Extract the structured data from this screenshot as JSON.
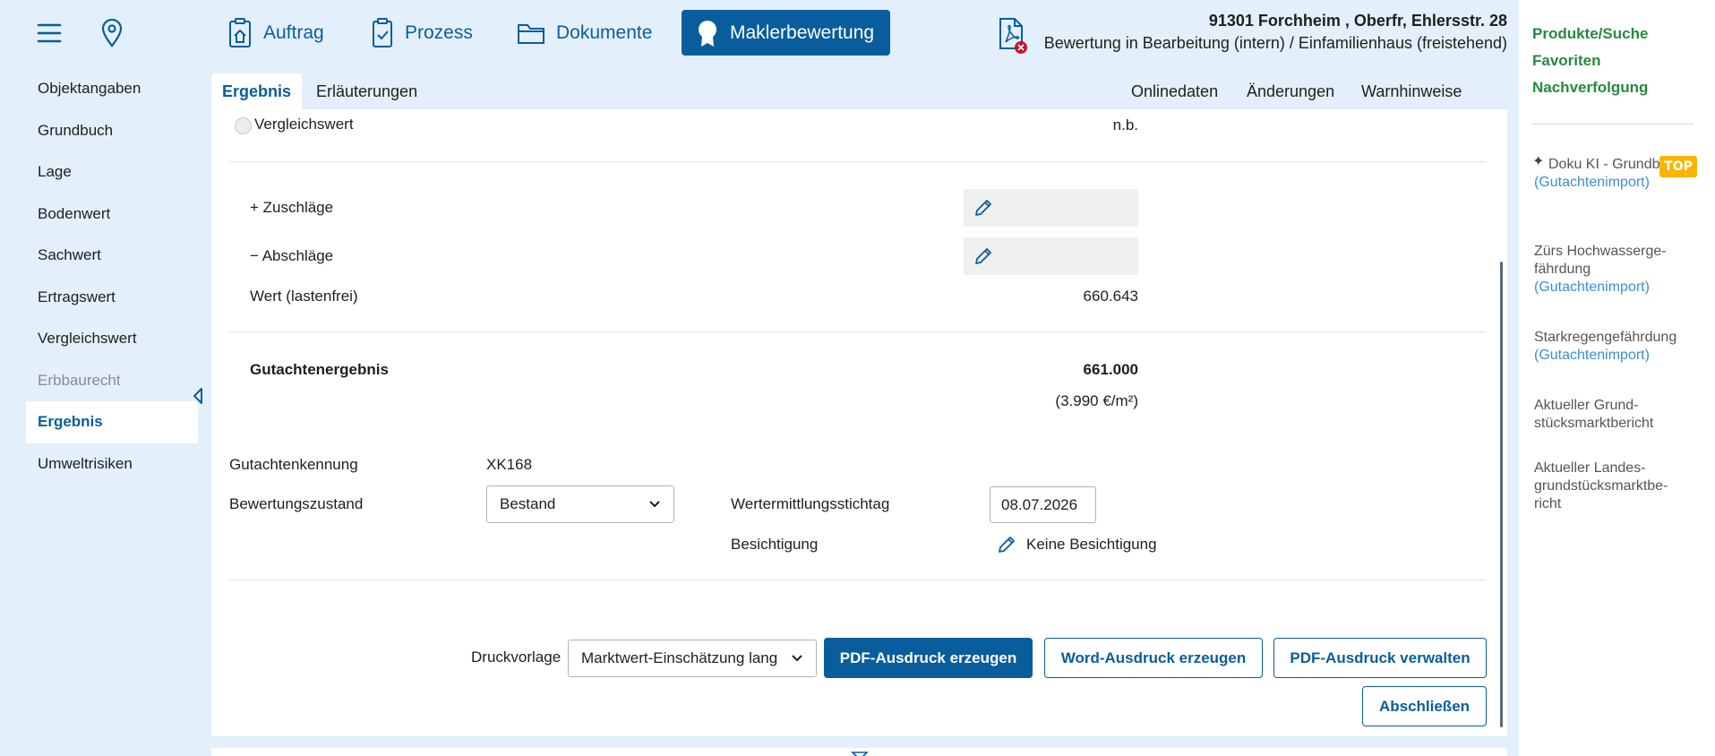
{
  "header": {
    "nav_tabs": [
      {
        "label": "Auftrag"
      },
      {
        "label": "Prozess"
      },
      {
        "label": "Dokumente"
      },
      {
        "label": "Maklerbewertung"
      }
    ],
    "address": "91301 Forchheim , Oberfr, Ehlersstr. 28",
    "status": "Bewertung in Bearbeitung (intern) / Einfamilienhaus (freistehend)"
  },
  "sidebar": {
    "items": [
      {
        "label": "Objektangaben"
      },
      {
        "label": "Grundbuch"
      },
      {
        "label": "Lage"
      },
      {
        "label": "Bodenwert"
      },
      {
        "label": "Sachwert"
      },
      {
        "label": "Ertragswert"
      },
      {
        "label": "Vergleichswert"
      },
      {
        "label": "Erbbaurecht"
      },
      {
        "label": "Ergebnis"
      },
      {
        "label": "Umweltrisiken"
      }
    ]
  },
  "subtabs": {
    "left": [
      {
        "label": "Ergebnis"
      },
      {
        "label": "Erläuterungen"
      }
    ],
    "right": [
      {
        "label": "Onlinedaten"
      },
      {
        "label": "Änderungen"
      },
      {
        "label": "Warnhinweise"
      }
    ]
  },
  "main": {
    "vergleichswert_label": "Vergleichswert",
    "vergleichswert_value": "n.b.",
    "zuschlaege_label": "+ Zuschläge",
    "abschlaege_label": "− Abschläge",
    "wert_label": "Wert (lastenfrei)",
    "wert_value": "660.643",
    "gutachtenergebnis_label": "Gutachtenergebnis",
    "gutachtenergebnis_value": "661.000",
    "per_sqm": "(3.990 €/m²)",
    "gutachtenkennung_label": "Gutachtenkennung",
    "gutachtenkennung_value": "XK168",
    "bewertungszustand_label": "Bewertungszustand",
    "bewertungszustand_value": "Bestand",
    "stichtag_label": "Wertermittlungsstichtag",
    "stichtag_value": "08.07.2026",
    "besichtigung_label": "Besichtigung",
    "besichtigung_value": "Keine Besichtigung"
  },
  "footer": {
    "druckvorlage_label": "Druckvorlage",
    "druckvorlage_value": "Marktwert-Einschätzung lang",
    "pdf_create": "PDF-Ausdruck erzeugen",
    "word_create": "Word-Ausdruck erzeugen",
    "pdf_manage": "PDF-Ausdruck verwalten",
    "finish": "Abschließen"
  },
  "right_panel": {
    "links": [
      {
        "label": "Produkte/Suche"
      },
      {
        "label": "Favoriten"
      },
      {
        "label": "Nachverfolgung"
      }
    ],
    "items": [
      {
        "title": "Doku KI - Grundbuch",
        "link": "(Gutachtenimport)"
      },
      {
        "title": "Zürs Hochwasserge-fährdung",
        "link": "(Gutachtenimport)"
      },
      {
        "title": "Starkregengefährdung",
        "link": "(Gutachtenimport)"
      },
      {
        "title": "Aktueller Grund-stücksmarktbericht"
      },
      {
        "title": "Aktueller Landes-grundstücksmarktbe-richt"
      }
    ],
    "badge": "TOP"
  },
  "colors": {
    "primary": "#0a5d9c",
    "green": "#248a3d",
    "link": "#3a8fd4",
    "badge": "#f7b500",
    "background": "#e3f0fb"
  }
}
